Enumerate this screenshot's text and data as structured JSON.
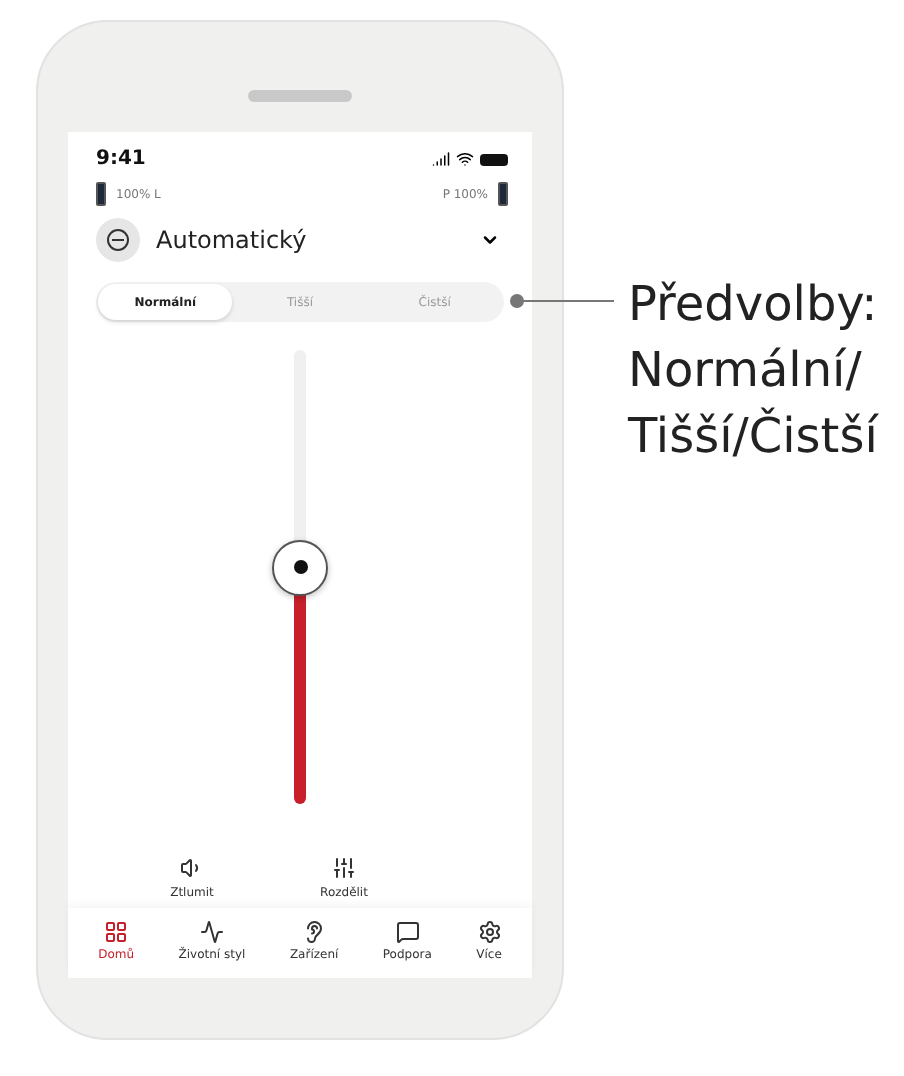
{
  "status_bar": {
    "time": "9:41"
  },
  "batteries": {
    "left": "100% L",
    "right": "P 100%"
  },
  "program": {
    "name": "Automatický"
  },
  "presets": [
    {
      "label": "Normální",
      "selected": true
    },
    {
      "label": "Tišší",
      "selected": false
    },
    {
      "label": "Čistší",
      "selected": false
    }
  ],
  "volume": {
    "level": 0.52
  },
  "actions": [
    {
      "kind": "mute",
      "label": "Ztlumit"
    },
    {
      "kind": "split",
      "label": "Rozdělit"
    }
  ],
  "nav": [
    {
      "kind": "home",
      "label": "Domů",
      "selected": true
    },
    {
      "kind": "lifestyle",
      "label": "Životní styl",
      "selected": false
    },
    {
      "kind": "device",
      "label": "Zařízení",
      "selected": false
    },
    {
      "kind": "support",
      "label": "Podpora",
      "selected": false
    },
    {
      "kind": "more",
      "label": "Více",
      "selected": false
    }
  ],
  "callout": {
    "text": "Předvolby: Normální/ Tišší/Čistší"
  }
}
